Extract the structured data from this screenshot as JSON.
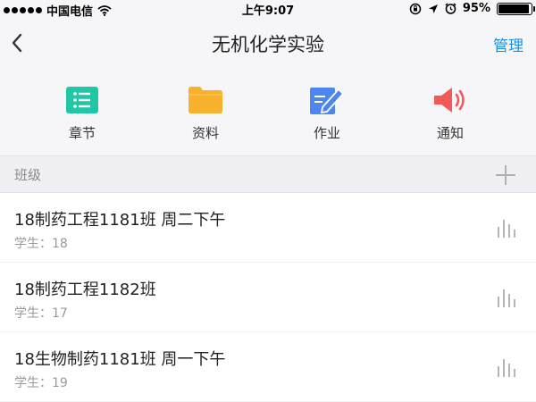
{
  "status_bar": {
    "carrier": "中国电信",
    "time": "上午9:07",
    "battery": "95%",
    "battery_level": 0.95,
    "icons": [
      "signal-icon",
      "wifi-icon",
      "lock-rotation-icon",
      "location-icon",
      "alarm-icon",
      "battery-icon"
    ]
  },
  "nav": {
    "title": "无机化学实验",
    "back_icon": "chevron-left-icon",
    "manage_label": "管理"
  },
  "quick_actions": [
    {
      "label": "章节",
      "icon": "list-icon",
      "color": "#1fc7a6"
    },
    {
      "label": "资料",
      "icon": "folder-icon",
      "color": "#f7b12c"
    },
    {
      "label": "作业",
      "icon": "edit-icon",
      "color": "#4e86f0"
    },
    {
      "label": "通知",
      "icon": "megaphone-icon",
      "color": "#f25a5a"
    }
  ],
  "section": {
    "title": "班级",
    "add_icon": "plus-icon"
  },
  "classes": [
    {
      "name": "18制药工程1181班 周二下午",
      "students": "学生：18"
    },
    {
      "name": "18制药工程1182班",
      "students": "学生：17"
    },
    {
      "name": "18生物制药1181班 周一下午",
      "students": "学生：19"
    }
  ],
  "colors": {
    "accent": "#1e8fe0",
    "background": "#f6f6f8",
    "section_bg": "#efeff4"
  }
}
